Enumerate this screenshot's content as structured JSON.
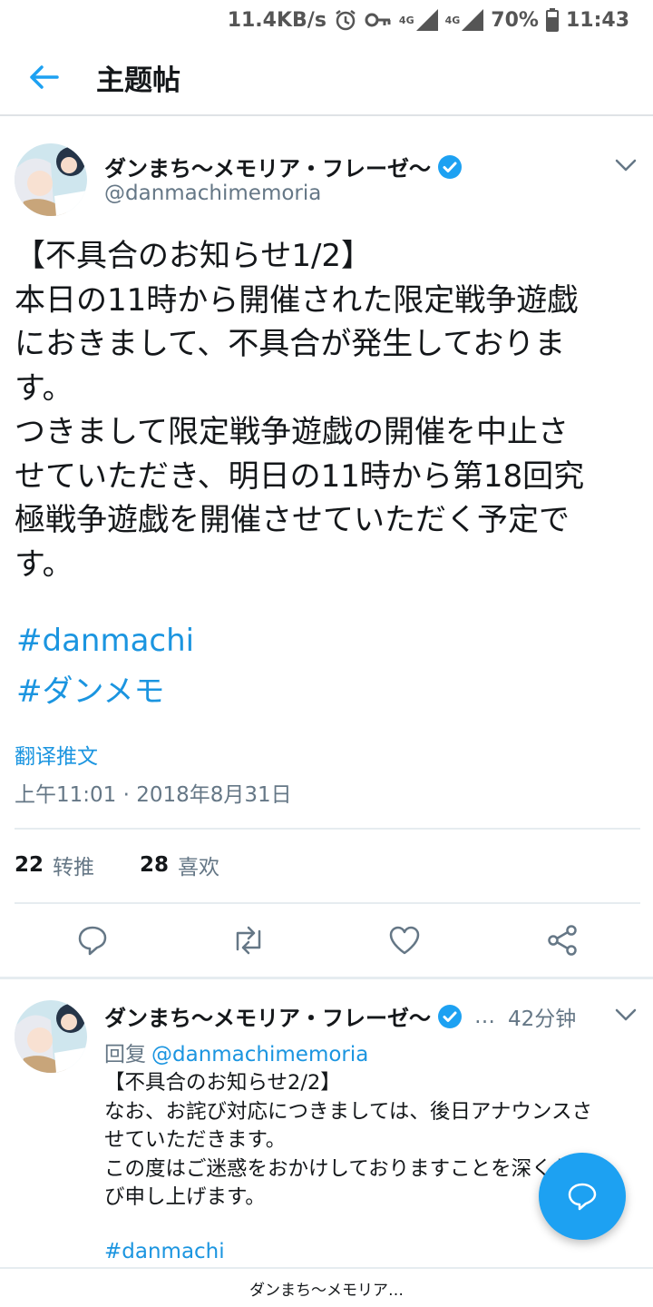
{
  "status_bar": {
    "net_speed": "11.4KB/s",
    "net1": "4G",
    "net2": "4G",
    "battery": "70%",
    "time": "11:43",
    "icons": [
      "alarm-icon",
      "key-icon",
      "signal-icon",
      "battery-icon"
    ]
  },
  "app_bar": {
    "title": "主题帖",
    "back_icon": "arrow-left-icon"
  },
  "tweet": {
    "display_name": "ダンまち〜メモリア・フレーゼ〜",
    "handle": "@danmachimemoria",
    "text_lines": [
      "【不具合のお知らせ1/2】",
      "本日の11時から開催された限定戦争遊戯",
      "におきまして、不具合が発生しておりま",
      "す。",
      "つきまして限定戦争遊戯の開催を中止さ",
      "せていただき、明日の11時から第18回究",
      "極戦争遊戯を開催させていただく予定で",
      "す。"
    ],
    "hashtags": [
      "#danmachi",
      "#ダンメモ"
    ],
    "translate": "翻译推文",
    "timestamp": "上午11:01 · 2018年8月31日",
    "retweets": "22",
    "retweets_label": "转推",
    "likes": "28",
    "likes_label": "喜欢"
  },
  "reply": {
    "display_name": "ダンまち〜メモリア・フレーゼ〜",
    "dots": "…",
    "time": "42分钟",
    "reply_label": "回复",
    "reply_handle": "@danmachimemoria",
    "text_lines": [
      "【不具合のお知らせ2/2】",
      "なお、お詫び対応につきましては、後日アナウンスさ",
      "せていただきます。",
      "この度はご迷惑をおかけしておりますことを深くお詫",
      "び申し上げます。"
    ],
    "hashtag": "#danmachi"
  },
  "bottom_bar": {
    "label": "ダンまち〜メモリア…"
  },
  "colors": {
    "accent": "#1da1f2",
    "link": "#1b95e0",
    "muted": "#657786"
  }
}
